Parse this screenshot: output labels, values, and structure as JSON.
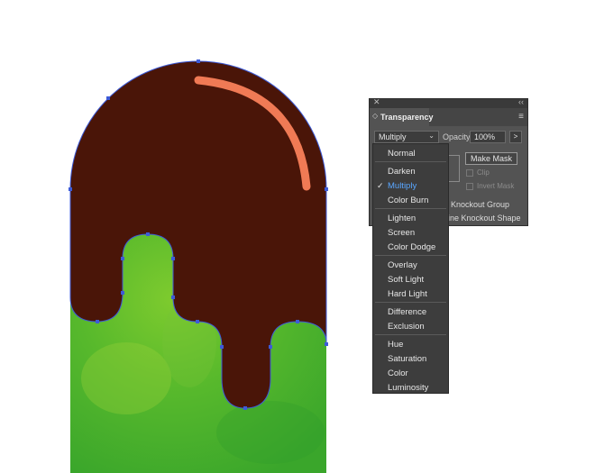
{
  "panel": {
    "close_glyph": "✕",
    "collapse_glyph": "‹‹",
    "tab_arrows": "◇",
    "title": "Transparency",
    "menu_glyph": "≡",
    "blend_mode": "Multiply",
    "opacity_label": "Opacity:",
    "opacity_value": "100%",
    "opacity_arrow": ">",
    "make_mask_label": "Make Mask",
    "clip_label": "Clip",
    "invert_mask_label": "Invert Mask",
    "knockout_group_label": "Knockout Group",
    "knockout_shape_label": "ine Knockout Shape"
  },
  "dropdown": {
    "selected": "Multiply",
    "check_glyph": "✓",
    "groups": [
      [
        "Normal"
      ],
      [
        "Darken",
        "Multiply",
        "Color Burn"
      ],
      [
        "Lighten",
        "Screen",
        "Color Dodge"
      ],
      [
        "Overlay",
        "Soft Light",
        "Hard Light"
      ],
      [
        "Difference",
        "Exclusion"
      ],
      [
        "Hue",
        "Saturation",
        "Color",
        "Luminosity"
      ]
    ]
  },
  "colors": {
    "chocolate": "#4a1508",
    "highlight": "#f07a55",
    "ice_cream_green": "#5cbf2e",
    "path_outline": "#3d5bd8",
    "selected_item": "#59a6ff",
    "panel_bg": "#535353",
    "menu_bg": "#3d3d3d"
  }
}
